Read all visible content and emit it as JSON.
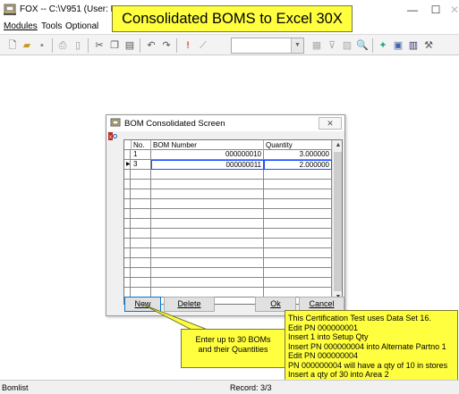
{
  "window": {
    "title": "FOX -- C:\\V951  (User: DO",
    "minimize_glyph": "—",
    "maximize_glyph": "☐",
    "close_glyph": "✕"
  },
  "menu": {
    "items": [
      {
        "label": "Modules"
      },
      {
        "label": "Tools"
      },
      {
        "label": "Optional"
      }
    ]
  },
  "toolbar": {
    "icons": [
      "new-file-icon",
      "open-folder-icon",
      "save-icon",
      "print-icon",
      "print-preview-icon",
      "cut-icon",
      "copy-icon",
      "paste-icon",
      "undo-icon",
      "redo-icon",
      "exclamation-icon",
      "chart-icon",
      "combo-box",
      "form-icon",
      "filter-icon",
      "report-icon",
      "preview-icon",
      "wizard-icon",
      "image-icon",
      "table-icon",
      "tools-icon"
    ],
    "combo_value": ""
  },
  "banner": {
    "text": "Consolidated BOMS to Excel 30X"
  },
  "dialog": {
    "title": "BOM Consolidated Screen",
    "close_glyph": "✕",
    "columns": [
      "No.",
      "BOM Number",
      "Quantity"
    ],
    "rows": [
      {
        "no": "1",
        "bom_number": "000000010",
        "quantity": "3.000000"
      },
      {
        "no": "3",
        "bom_number": "000000011",
        "quantity": "2.000000"
      },
      {
        "no": "",
        "bom_number": "",
        "quantity": ""
      },
      {
        "no": "",
        "bom_number": "",
        "quantity": ""
      },
      {
        "no": "",
        "bom_number": "",
        "quantity": ""
      },
      {
        "no": "",
        "bom_number": "",
        "quantity": ""
      },
      {
        "no": "",
        "bom_number": "",
        "quantity": ""
      },
      {
        "no": "",
        "bom_number": "",
        "quantity": ""
      },
      {
        "no": "",
        "bom_number": "",
        "quantity": ""
      },
      {
        "no": "",
        "bom_number": "",
        "quantity": ""
      },
      {
        "no": "",
        "bom_number": "",
        "quantity": ""
      },
      {
        "no": "",
        "bom_number": "",
        "quantity": ""
      },
      {
        "no": "",
        "bom_number": "",
        "quantity": ""
      },
      {
        "no": "",
        "bom_number": "",
        "quantity": ""
      },
      {
        "no": "",
        "bom_number": "",
        "quantity": ""
      },
      {
        "no": "",
        "bom_number": "",
        "quantity": ""
      }
    ],
    "selected_row": 2,
    "buttons": {
      "new": "New",
      "delete": "Delete",
      "ok": "Ok",
      "cancel": "Cancel"
    }
  },
  "callouts": {
    "left": [
      "Enter up to 30 BOMs",
      "and their Quantities"
    ],
    "right": [
      "This Certification Test uses Data Set 16.",
      "Edit PN 000000001",
      "Insert 1 into Setup Qty",
      "Insert PN 000000004 into Alternate Partno 1",
      "Edit PN 000000004",
      "PN 000000004 will have a qty of 10 in stores",
      "Insert a qty of 30 into Area 2"
    ]
  },
  "status": {
    "left": "Bomlist",
    "record": "Record: 3/3"
  },
  "colors": {
    "callout_bg": "#ffff40",
    "selection_border": "#1e4fff"
  }
}
